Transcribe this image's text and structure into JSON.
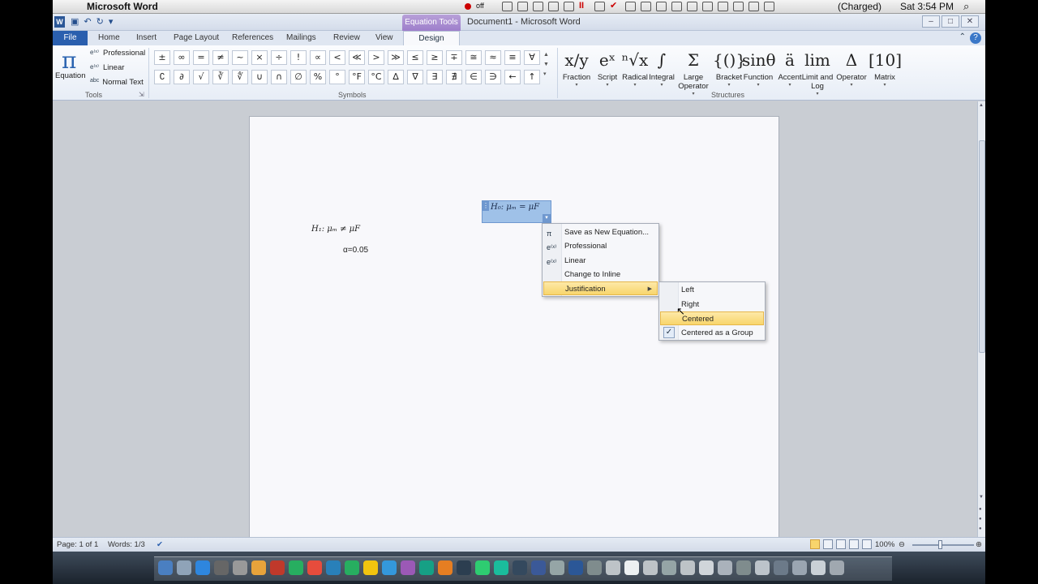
{
  "mac_menubar": {
    "app_name": "Microsoft Word",
    "battery": "(Charged)",
    "clock": "Sat 3:54 PM",
    "off_label": "off"
  },
  "titlebar": {
    "context_tab": "Equation Tools",
    "doc_title": "Document1 - Microsoft Word",
    "app_icon": "W"
  },
  "tabs": [
    "File",
    "Home",
    "Insert",
    "Page Layout",
    "References",
    "Mailings",
    "Review",
    "View",
    "Design"
  ],
  "tools_group": {
    "equation_label": "Equation",
    "professional": "Professional",
    "linear": "Linear",
    "normal_text_prefix": "abc",
    "normal_text": "Normal Text",
    "group_label": "Tools"
  },
  "symbols_group": {
    "row1": [
      "±",
      "∞",
      "=",
      "≠",
      "~",
      "×",
      "÷",
      "!",
      "∝",
      "<",
      "≪",
      ">",
      "≫",
      "≤",
      "≥",
      "∓",
      "≅",
      "≈",
      "≡",
      "∀"
    ],
    "row2": [
      "∁",
      "∂",
      "√",
      "∛",
      "∜",
      "∪",
      "∩",
      "∅",
      "%",
      "°",
      "°F",
      "°C",
      "∆",
      "∇",
      "∃",
      "∄",
      "∈",
      "∋",
      "←",
      "↑"
    ],
    "group_label": "Symbols"
  },
  "structures_group": {
    "items": [
      {
        "glyph": "x/y",
        "label": "Fraction"
      },
      {
        "glyph": "eˣ",
        "label": "Script"
      },
      {
        "glyph": "ⁿ√x",
        "label": "Radical"
      },
      {
        "glyph": "∫",
        "label": "Integral"
      },
      {
        "glyph": "Σ",
        "label": "Large Operator"
      },
      {
        "glyph": "{()}",
        "label": "Bracket"
      },
      {
        "glyph": "sinθ",
        "label": "Function"
      },
      {
        "glyph": "ä",
        "label": "Accent"
      },
      {
        "glyph": "lim",
        "label": "Limit and Log"
      },
      {
        "glyph": "Δ",
        "label": "Operator"
      },
      {
        "glyph": "[10]",
        "label": "Matrix"
      }
    ],
    "group_label": "Structures"
  },
  "document": {
    "h1_equation": "H₁: μₘ ≠ μF",
    "alpha_line": "α=0.05",
    "selected_equation": "H₀: μₘ = μF"
  },
  "equation_menu": {
    "items": [
      "Save as New Equation...",
      "Professional",
      "Linear",
      "Change to Inline",
      "Justification"
    ],
    "highlighted": "Justification"
  },
  "justification_submenu": {
    "items": [
      "Left",
      "Right",
      "Centered",
      "Centered as a Group"
    ],
    "highlighted": "Centered",
    "checked": "Centered as a Group"
  },
  "statusbar": {
    "page": "Page: 1 of 1",
    "words": "Words: 1/3",
    "zoom": "100%"
  },
  "colors": {
    "file_tab": "#2a5fae",
    "context_tab": "#9d7ecb",
    "selection": "#9fc1e8",
    "menu_highlight": "#f8d56c"
  }
}
